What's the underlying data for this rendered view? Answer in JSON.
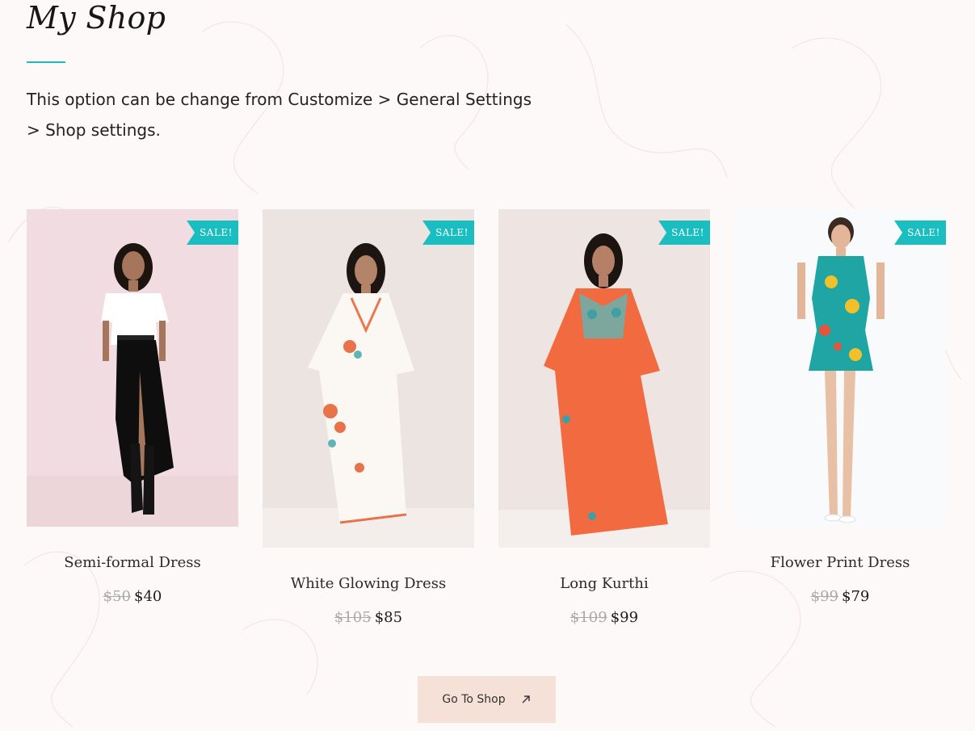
{
  "section": {
    "title": "My Shop",
    "description": "This option can be change from Customize > General Settings > Shop settings."
  },
  "products": [
    {
      "name": "Semi-formal Dress",
      "old_price": "$50",
      "new_price": "$40",
      "badge": "SALE!"
    },
    {
      "name": "White Glowing Dress",
      "old_price": "$105",
      "new_price": "$85",
      "badge": "SALE!"
    },
    {
      "name": "Long Kurthi",
      "old_price": "$109",
      "new_price": "$99",
      "badge": "SALE!"
    },
    {
      "name": "Flower Print Dress",
      "old_price": "$99",
      "new_price": "$79",
      "badge": "SALE!"
    }
  ],
  "cta": {
    "label": "Go To Shop",
    "icon": "arrow-up-right-icon"
  },
  "colors": {
    "accent": "#22b9bd",
    "badge": "#1bbec0",
    "button_bg": "#f5e1d7",
    "background": "#fcf9f8"
  }
}
